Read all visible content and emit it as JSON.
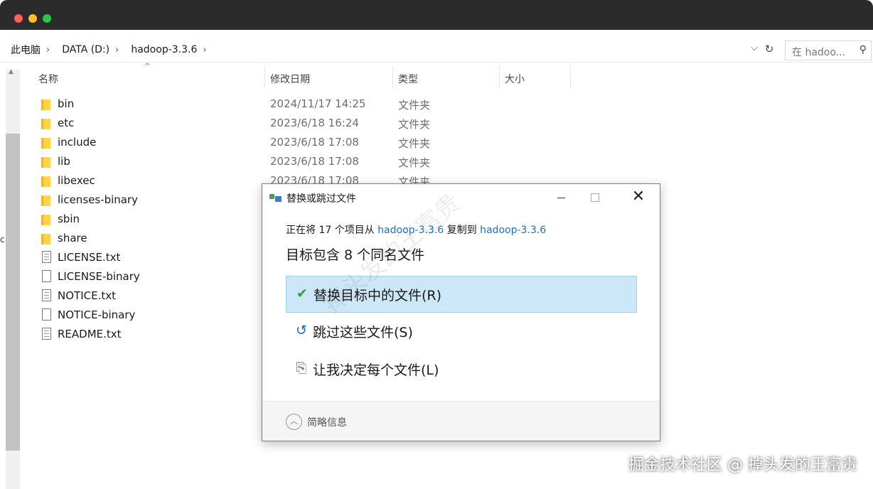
{
  "window": {
    "traffic_lights": [
      "close",
      "minimize",
      "zoom"
    ]
  },
  "address_bar": {
    "breadcrumbs": [
      "此电脑",
      "DATA (D:)",
      "hadoop-3.3.6"
    ],
    "search_placeholder": "在 hadoo..."
  },
  "columns": {
    "name": "名称",
    "date": "修改日期",
    "type": "类型",
    "size": "大小"
  },
  "files": [
    {
      "name": "bin",
      "date": "2024/11/17 14:25",
      "type": "文件夹",
      "icon": "folder-icon"
    },
    {
      "name": "etc",
      "date": "2023/6/18 16:24",
      "type": "文件夹",
      "icon": "folder-icon"
    },
    {
      "name": "include",
      "date": "2023/6/18 17:08",
      "type": "文件夹",
      "icon": "folder-icon"
    },
    {
      "name": "lib",
      "date": "2023/6/18 17:08",
      "type": "文件夹",
      "icon": "folder-icon"
    },
    {
      "name": "libexec",
      "date": "2023/6/18 17:08",
      "type": "文件夹",
      "icon": "folder-icon"
    },
    {
      "name": "licenses-binary",
      "date": "",
      "type": "",
      "icon": "folder-icon"
    },
    {
      "name": "sbin",
      "date": "",
      "type": "",
      "icon": "folder-icon"
    },
    {
      "name": "share",
      "date": "",
      "type": "",
      "icon": "folder-icon"
    },
    {
      "name": "LICENSE.txt",
      "date": "",
      "type": "",
      "icon": "text-file-icon"
    },
    {
      "name": "LICENSE-binary",
      "date": "",
      "type": "",
      "icon": "file-icon"
    },
    {
      "name": "NOTICE.txt",
      "date": "",
      "type": "",
      "icon": "text-file-icon"
    },
    {
      "name": "NOTICE-binary",
      "date": "",
      "type": "",
      "icon": "file-icon"
    },
    {
      "name": "README.txt",
      "date": "",
      "type": "",
      "icon": "text-file-icon"
    }
  ],
  "nav": {
    "partial_label": "c"
  },
  "dialog": {
    "title": "替换或跳过文件",
    "copy_prefix": "正在将 17 个项目从 ",
    "source": "hadoop-3.3.6",
    "copy_middle": " 复制到 ",
    "destination": "hadoop-3.3.6",
    "heading": "目标包含 8 个同名文件",
    "options": [
      {
        "label": "替换目标中的文件(R)",
        "icon": "checkmark-icon",
        "selected": true
      },
      {
        "label": "跳过这些文件(S)",
        "icon": "undo-icon",
        "selected": false
      },
      {
        "label": "让我决定每个文件(L)",
        "icon": "compare-files-icon",
        "selected": false
      }
    ],
    "details_label": "简略信息"
  },
  "watermark": {
    "diagonal": "掉头发的王富贵",
    "corner": "掘金技术社区 @ 掉头发的王富贵"
  },
  "colors": {
    "titlebar": "#2b2b2b",
    "link": "#1f6fb8",
    "selected_option": "#cce8f8",
    "folder": "#ffd34d"
  }
}
